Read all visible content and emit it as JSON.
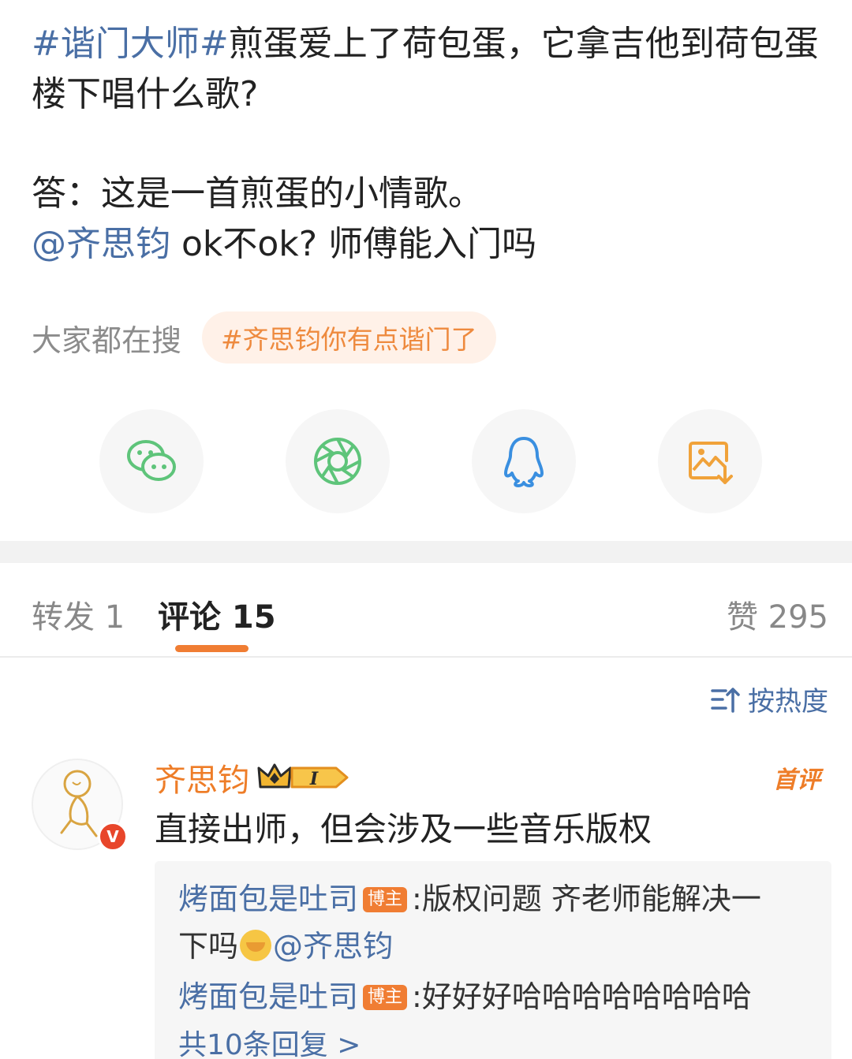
{
  "post": {
    "topic": "#谐门大师#",
    "line1_rest": "煎蛋爱上了荷包蛋，它拿吉他到荷包蛋",
    "line2": "楼下唱什么歌?",
    "answer": "答：这是一首煎蛋的小情歌。",
    "mention": "@齐思钧",
    "mention_tail": " ok不ok? 师傅能入门吗"
  },
  "hot_search": {
    "label": "大家都在搜",
    "chip": "#齐思钧你有点谐门了"
  },
  "share": {
    "icons": [
      "wechat-icon",
      "moments-icon",
      "qq-icon",
      "save-image-icon"
    ],
    "colors": {
      "wechat": "#5ec47a",
      "moments": "#5ec47a",
      "qq": "#3a8fe0",
      "save": "#f0a23a"
    }
  },
  "tabs": {
    "repost": "转发 1",
    "comments": "评论 15",
    "likes": "赞 295"
  },
  "sort": {
    "label": "按热度"
  },
  "comment": {
    "author": "齐思钧",
    "level": "I",
    "first_badge": "首评",
    "text": "直接出师，但会涉及一些音乐版权",
    "verified": "V"
  },
  "replies": [
    {
      "author": "烤面包是吐司",
      "tag": "博主",
      "text_a": ":版权问题 齐老师能解决一",
      "text_b": "下吗",
      "mention": "@齐思钧"
    },
    {
      "author": "烤面包是吐司",
      "tag": "博主",
      "text_a": ":好好好哈哈哈哈哈哈哈哈"
    }
  ],
  "more_replies": "共10条回复 >",
  "colors": {
    "accent": "#f07d33",
    "link": "#4a6fa5",
    "chip_bg": "#fff1e8"
  }
}
